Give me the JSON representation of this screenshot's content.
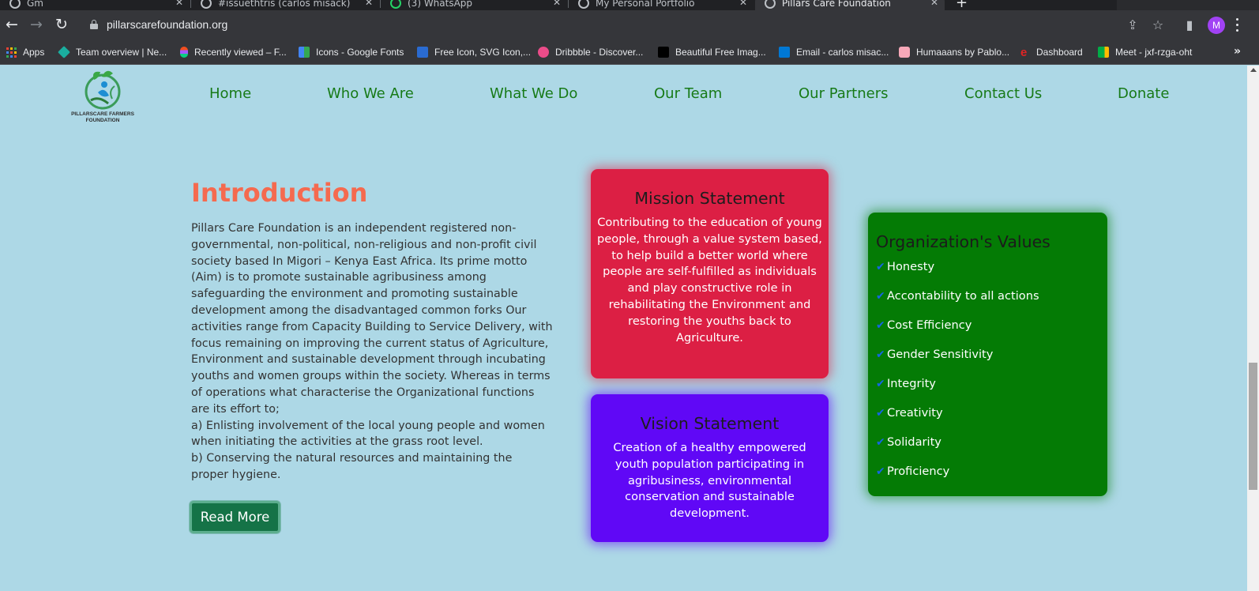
{
  "browser": {
    "tabs": [
      {
        "title": "Gm"
      },
      {
        "title": "#issuethtris (carlos misack)"
      },
      {
        "title": "(3) WhatsApp"
      },
      {
        "title": "My Personal Portfolio"
      },
      {
        "title": "Pillars Care Foundation"
      }
    ],
    "url": "pillarscarefoundation.org",
    "profile_initial": "M",
    "bookmarks": [
      {
        "label": "Apps",
        "icon": "apps-grid-icon"
      },
      {
        "label": "Team overview | Ne...",
        "icon": "team-icon",
        "color": "#1aae9f"
      },
      {
        "label": "Recently viewed – F...",
        "icon": "figma-icon",
        "color": "#f24e1e"
      },
      {
        "label": "Icons - Google Fonts",
        "icon": "google-fonts-icon",
        "color": "#4285f4"
      },
      {
        "label": "Free Icon, SVG Icon,...",
        "icon": "flaticon-icon",
        "color": "#2a6bd1"
      },
      {
        "label": "Dribbble - Discover...",
        "icon": "dribbble-icon",
        "color": "#ea4c89"
      },
      {
        "label": "Beautiful Free Imag...",
        "icon": "unsplash-icon",
        "color": "#000000"
      },
      {
        "label": "Email - carlos misac...",
        "icon": "outlook-icon",
        "color": "#0078d4"
      },
      {
        "label": "Humaaans by Pablo...",
        "icon": "humaaans-icon",
        "color": "#f7a8b8"
      },
      {
        "label": "Dashboard",
        "icon": "dashboard-icon",
        "color": "#e02424"
      },
      {
        "label": "Meet - jxf-rzga-oht",
        "icon": "meet-icon",
        "color": "#00ac47"
      }
    ]
  },
  "site": {
    "logo_text": "PILLARSCARE FARMERS FOUNDATION",
    "nav": [
      "Home",
      "Who We Are",
      "What We Do",
      "Our Team",
      "Our Partners",
      "Contact Us",
      "Donate"
    ]
  },
  "intro": {
    "title": "Introduction",
    "paragraph": "Pillars Care Foundation is an independent registered non-governmental, non-political, non-religious and non-profit civil society based In Migori – Kenya East Africa. Its prime motto (Aim) is to promote sustainable agribusiness among safeguarding the environment and promoting sustainable development among the disadvantaged common forks Our activities range from Capacity Building to Service Delivery, with focus remaining on improving the current status of Agriculture, Environment and sustainable development through incubating youths and women groups within the society. Whereas in terms of operations what characterise the Organizational functions are its effort to;",
    "point_a": "a) Enlisting involvement of the local young people and women when initiating the activities at the grass root level.",
    "point_b": "b) Conserving the natural resources and maintaining the proper hygiene.",
    "button": "Read More"
  },
  "mission": {
    "title": "Mission Statement",
    "body": "Contributing to the education of young people, through a value system based, to help build a better world where people are self-fulfilled as individuals and play constructive role in rehabilitating the Environment and restoring the youths back to Agriculture.",
    "color": "#dc1f44"
  },
  "vision": {
    "title": "Vision Statement",
    "body": "Creation of a healthy empowered youth population participating in agribusiness, environmental conservation and sustainable development.",
    "color": "#6008f6"
  },
  "values": {
    "title": "Organization's Values",
    "items": [
      "Honesty",
      "Accontability to all actions",
      "Cost Efficiency",
      "Gender Sensitivity",
      "Integrity",
      "Creativity",
      "Solidarity",
      "Proficiency"
    ],
    "color": "#047b05"
  }
}
